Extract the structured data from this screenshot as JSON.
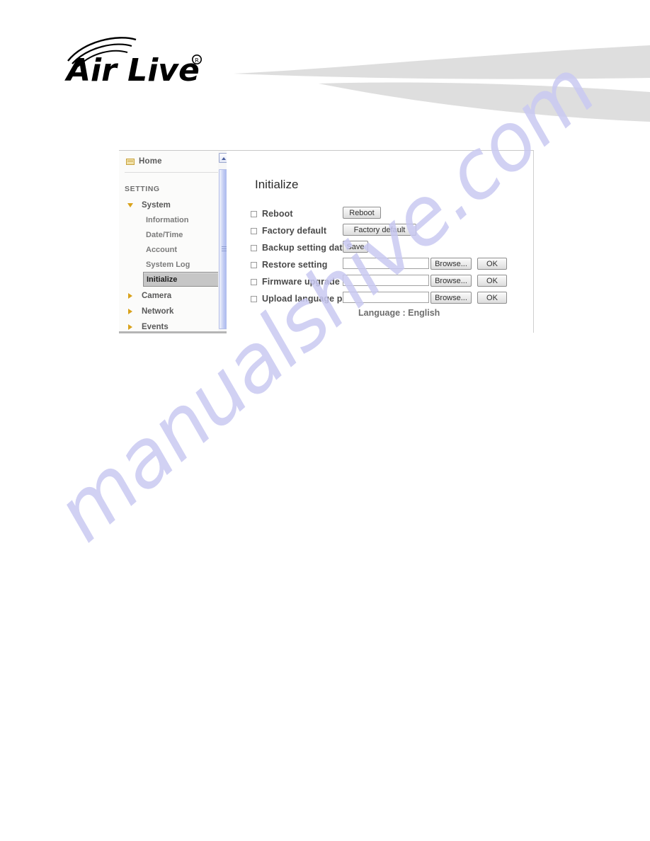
{
  "header": {
    "brand_name": "Air Live",
    "brand_mark": "registered-trademark",
    "swoosh_color": "#dcdcdc"
  },
  "sidebar": {
    "home": {
      "label": "Home",
      "icon": "home-icon"
    },
    "section_label": "SETTING",
    "groups": [
      {
        "label": "System",
        "expanded": true,
        "icon": "chevron-down-icon",
        "children": [
          {
            "label": "Information",
            "selected": false
          },
          {
            "label": "Date/Time",
            "selected": false
          },
          {
            "label": "Account",
            "selected": false
          },
          {
            "label": "System Log",
            "selected": false
          },
          {
            "label": "Initialize",
            "selected": true
          }
        ]
      },
      {
        "label": "Camera",
        "expanded": false,
        "icon": "chevron-right-icon",
        "children": []
      },
      {
        "label": "Network",
        "expanded": false,
        "icon": "chevron-right-icon",
        "children": []
      },
      {
        "label": "Events",
        "expanded": false,
        "icon": "chevron-right-icon",
        "children": []
      }
    ],
    "scrollbar": {
      "up_arrow": "scroll-up-icon",
      "thumb": "scroll-thumb"
    }
  },
  "main": {
    "title": "Initialize",
    "rows": [
      {
        "label": "Reboot",
        "checked": false,
        "button": "Reboot",
        "has_field": false
      },
      {
        "label": "Factory default",
        "checked": false,
        "button": "Factory default",
        "has_field": false
      },
      {
        "label": "Backup setting data",
        "checked": false,
        "button": "Save",
        "has_field": false
      },
      {
        "label": "Restore setting",
        "checked": false,
        "has_field": true,
        "field_value": "",
        "browse": "Browse...",
        "ok": "OK"
      },
      {
        "label": "Firmware upgrade",
        "checked": false,
        "has_field": true,
        "field_value": "",
        "browse": "Browse...",
        "ok": "OK"
      },
      {
        "label": "Upload language pack",
        "checked": false,
        "has_field": true,
        "field_value": "",
        "browse": "Browse...",
        "ok": "OK"
      }
    ],
    "language_note": "Language : English"
  },
  "watermark": {
    "text": "manualshive.com",
    "color": "#c9c9f2"
  }
}
